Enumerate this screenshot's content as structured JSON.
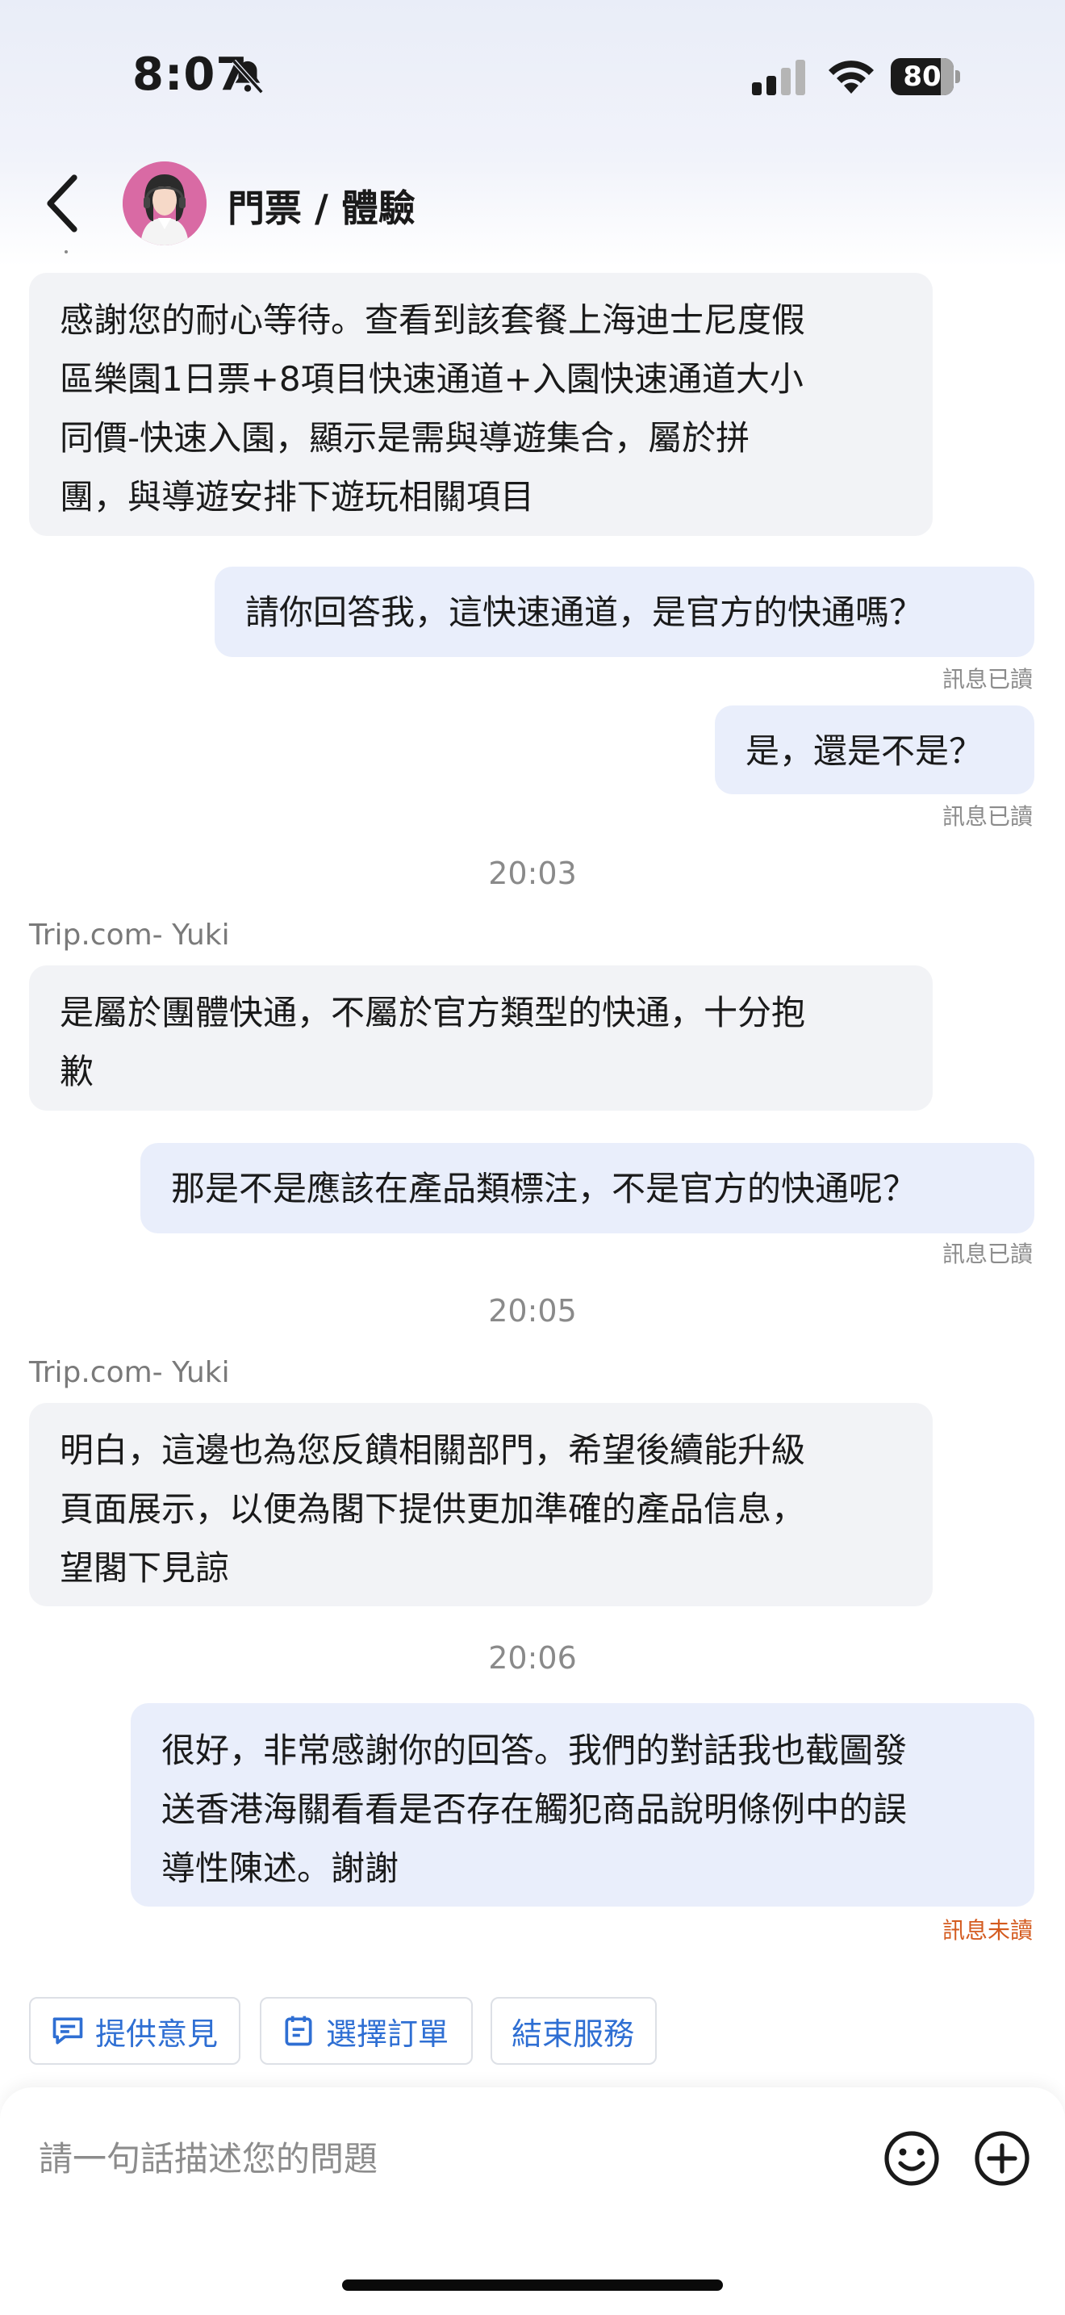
{
  "status_bar": {
    "time": "8:07",
    "battery_percent": "80",
    "battery_level": 0.8
  },
  "header": {
    "title": "門票 / 體驗"
  },
  "messages": [
    {
      "direction": "in",
      "text_lines": [
        "感謝您的耐心等待。查看到該套餐上海迪士尼度假",
        "區樂園1日票+8項目快速通道+入園快速通道大小",
        "同價-快速入園，顯示是需與導遊集合，屬於拼",
        "團，與導遊安排下遊玩相關項目"
      ]
    },
    {
      "direction": "out",
      "text": "請你回答我，這快速通道，是官方的快通嗎？",
      "status": "訊息已讀"
    },
    {
      "direction": "out",
      "text": "是，還是不是？",
      "status": "訊息已讀"
    },
    {
      "time": "20:03"
    },
    {
      "sender": "Trip.com- Yuki"
    },
    {
      "direction": "in",
      "text_lines": [
        "是屬於團體快通，不屬於官方類型的快通，十分抱",
        "歉"
      ]
    },
    {
      "direction": "out",
      "text": "那是不是應該在產品類標注，不是官方的快通呢？",
      "status": "訊息已讀"
    },
    {
      "time": "20:05"
    },
    {
      "sender": "Trip.com- Yuki"
    },
    {
      "direction": "in",
      "text_lines": [
        "明白，這邊也為您反饋相關部門，希望後續能升級",
        "頁面展示，以便為閣下提供更加準確的產品信息，",
        "望閣下見諒"
      ]
    },
    {
      "time": "20:06"
    },
    {
      "direction": "out",
      "text_lines": [
        "很好，非常感謝你的回答。我們的對話我也截圖發",
        "送香港海關看看是否存在觸犯商品說明條例中的誤",
        "導性陳述。謝謝"
      ],
      "status": "訊息未讀"
    }
  ],
  "quick_actions": [
    "提供意見",
    "選擇訂單",
    "結束服務"
  ],
  "input": {
    "placeholder": "請一句話描述您的問題"
  },
  "colors": {
    "accent": "#2f6fd3",
    "incoming_bubble": "#f2f3f6",
    "outgoing_bubble": "#e9eefb",
    "unread": "#d45b1f"
  },
  "icons": [
    "bell-slash-icon",
    "signal-icon",
    "wifi-icon",
    "battery-icon",
    "back-arrow-icon",
    "feedback-icon",
    "order-icon",
    "emoji-icon",
    "plus-icon"
  ]
}
